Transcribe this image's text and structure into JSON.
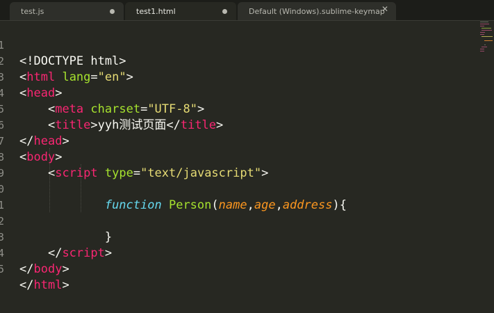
{
  "tabs": [
    {
      "label": "test.js",
      "state": "unsaved"
    },
    {
      "label": "test1.html",
      "state": "unsaved"
    },
    {
      "label": "Default (Windows).sublime-keymap",
      "state": "close"
    }
  ],
  "active_tab": 1,
  "line_numbers": [
    "1",
    "2",
    "3",
    "4",
    "5",
    "6",
    "7",
    "8",
    "9",
    "0",
    "1",
    "2",
    "3",
    "4",
    "5"
  ],
  "colors": {
    "background": "#272822",
    "tag": "#f92672",
    "attribute": "#a6e22e",
    "string": "#e6db74",
    "keyword": "#66d9ef",
    "parameter": "#fd971f"
  },
  "code": {
    "doctype": "<!DOCTYPE html>",
    "html_tag": "html",
    "lang_attr": "lang",
    "lang_val": "\"en\"",
    "head_tag": "head",
    "meta_tag": "meta",
    "charset_attr": "charset",
    "charset_val": "\"UTF-8\"",
    "title_tag": "title",
    "title_text": "yyh测试页面",
    "body_tag": "body",
    "script_tag": "script",
    "type_attr": "type",
    "type_val": "\"text/javascript\"",
    "fn_keyword": "function",
    "fn_name": "Person",
    "param1": "name",
    "param2": "age",
    "param3": "address",
    "close_brace": "}"
  }
}
